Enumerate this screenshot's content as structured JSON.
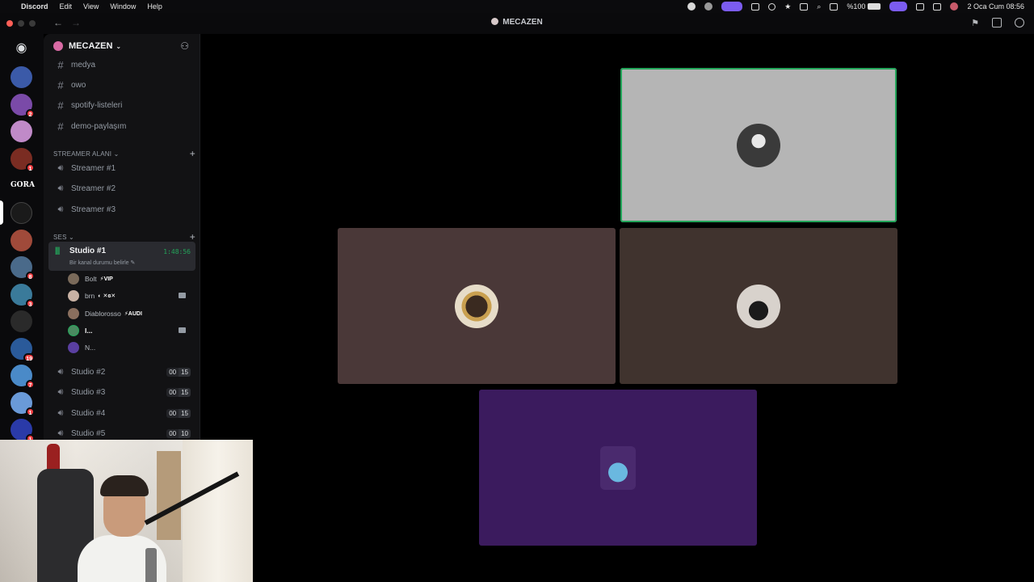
{
  "menubar": {
    "items": [
      "Discord",
      "Edit",
      "View",
      "Window",
      "Help"
    ],
    "battery": "%100",
    "datetime": "2 Oca Cum  08:56"
  },
  "window": {
    "title": "MECAZEN"
  },
  "server": {
    "name": "MECAZEN",
    "chevron": "⌄"
  },
  "rail": {
    "badges": [
      "2",
      "1",
      "8",
      "3",
      "19",
      "7",
      "1",
      "1"
    ],
    "gora_label": "GORA"
  },
  "text_channels": [
    "medya",
    "owo",
    "spotify-listeleri",
    "demo-paylaşım"
  ],
  "categories": {
    "streamer": "STREAMER ALANI ⌄",
    "ses": "SES ⌄"
  },
  "streamer_channels": [
    "Streamer #1",
    "Streamer #2",
    "Streamer #3"
  ],
  "active_channel": {
    "name": "Studio #1",
    "timer": "1:48:56",
    "status_placeholder": "Bir kanal durumu belirle ✎"
  },
  "members": [
    {
      "name": "Bolt",
      "tag": "⚡VIP",
      "color": "#7a6a5a",
      "camera": false
    },
    {
      "name": "brn",
      "tag": "◐ ✕ɞ✕",
      "color": "#c9b2a4",
      "camera": true
    },
    {
      "name": "Diablorosso",
      "tag": "⚡AUDI",
      "color": "#8a6f5e",
      "camera": false
    },
    {
      "name": "l...",
      "tag": "",
      "color": "#4a8a60",
      "camera": true
    },
    {
      "name": "N...",
      "tag": "",
      "color": "#5a3fa0",
      "camera": false
    }
  ],
  "voice_channels": [
    {
      "name": "Studio #2",
      "count": "00",
      "limit": "15"
    },
    {
      "name": "Studio #3",
      "count": "00",
      "limit": "15"
    },
    {
      "name": "Studio #4",
      "count": "00",
      "limit": "15"
    },
    {
      "name": "Studio #5",
      "count": "00",
      "limit": "10"
    }
  ],
  "tiles": [
    {
      "user": "brn",
      "bg": "#b5b5b5",
      "speaking": true,
      "avatar": "#3a3a3a"
    },
    {
      "user": "Diablorosso",
      "bg": "#4a3838",
      "speaking": false,
      "avatar": "#5a4030"
    },
    {
      "user": "Bolt",
      "bg": "#40332e",
      "speaking": false,
      "avatar": "#d8d2cc"
    },
    {
      "user": "N...",
      "bg": "#3b1b5e",
      "speaking": false,
      "avatar": "#4a88a8"
    }
  ],
  "colors": {
    "speaking_green": "#23a55a",
    "notification_red": "#f23f43",
    "sidebar_bg": "#121214"
  }
}
